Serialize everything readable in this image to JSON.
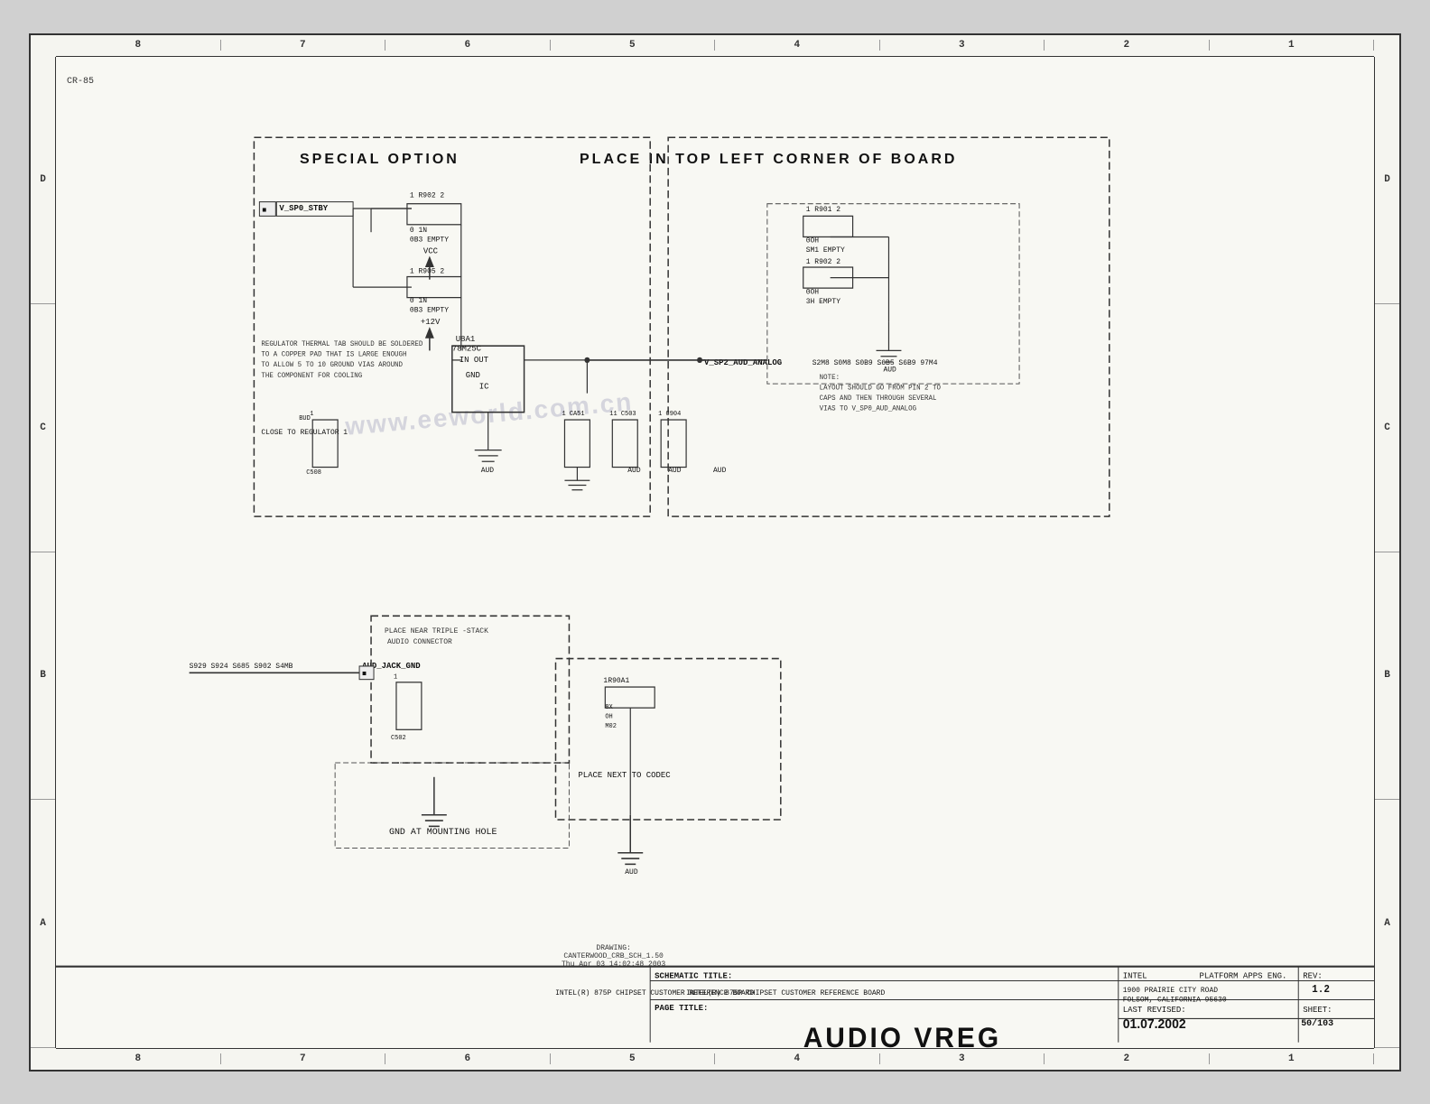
{
  "sheet": {
    "title": "AUDIO VREG",
    "schematic_title": "SCHEMATIC TITLE:",
    "intel_schematic": "INTEL(R) 875P CHIPSET CUSTOMER REFERENCE BOARD",
    "page_title": "PAGE TITLE:",
    "rev_label": "REV:",
    "rev_value": "1.2",
    "sheet_label": "SHEET:",
    "sheet_value": "50/103",
    "intel_label": "INTEL",
    "platform_label": "PLATFORM APPS ENG.",
    "last_revised_label": "LAST REVISED:",
    "last_revised_value": "01.07.2002",
    "address": "1900 PRAIRIE CITY ROAD\nFOLSOM, CALIFORNIA 95630",
    "drawing_info": "DRAWING:\nCANTERWOOD_CRB_SCH_1.50\nThu Apr 03 14:02:48 2003"
  },
  "border": {
    "top_numbers": [
      "8",
      "7",
      "6",
      "5",
      "4",
      "3",
      "2",
      "1"
    ],
    "bottom_numbers": [
      "8",
      "7",
      "6",
      "5",
      "4",
      "3",
      "2",
      "1"
    ],
    "left_letters": [
      "D",
      "C",
      "B",
      "A"
    ],
    "right_letters": [
      "D",
      "C",
      "B",
      "A"
    ]
  },
  "labels": {
    "special_option": "SPECIAL  OPTION",
    "place_top_left": "PLACE  IN  TOP  LEFT  CORNER  OF  BOARD",
    "corner_word": "CORNER",
    "cr85": "CR-85",
    "place_near_triple": "PLACE NEAR TRIPLE -STACK\nAUDIO CONNECTOR",
    "place_next_codec": "PLACE NEXT TO CODEC",
    "gnd_mounting": "GND AT MOUNTING HOLE",
    "vcc": "VCC",
    "plus12v": "+12V",
    "aud": "AUD",
    "aud_jack_gnd": "AUD_JACK_GND",
    "watermark": "www.eeworld.com.cn",
    "regulator_note": "REGULATOR THERMAL TAB SHOULD BE SOLDERED\nTO A COPPER PAD THAT IS LARGE ENOUGH\nTO ALLOW 5 TO 10 GROUND VIAS AROUND\nTHE COMPONENT FOR COOLING",
    "layout_note": "NOTE:\nLAYOUT SHOULD GO FROM PIN 2 TO\nCAPS AND THEN THROUGH SEVERAL\nVIAS TO V_SP0_AUD_ANALOG",
    "close_to_reg": "CLOSE TO REGULATOR",
    "u8a1_label": "U8A1\n78M25C",
    "v_sp0_stby": "V_SP0_STBY",
    "v_sp2_aud_analog": "V_SP2_AUD_ANALOG"
  }
}
